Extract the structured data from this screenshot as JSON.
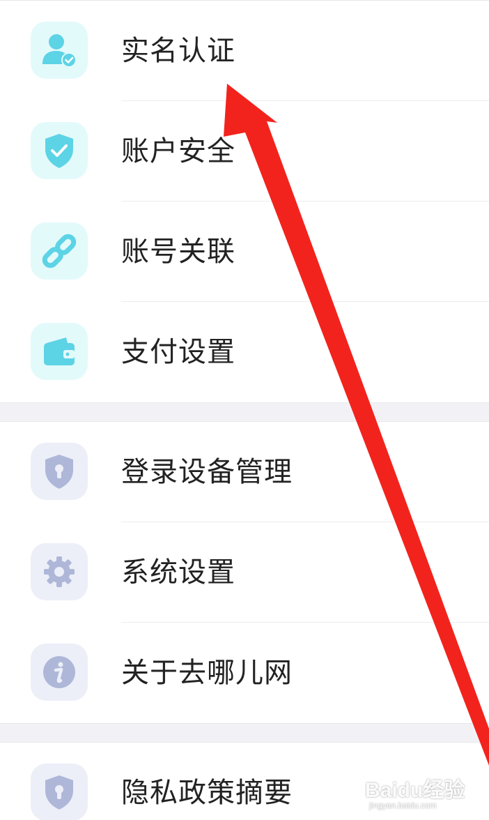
{
  "colors": {
    "teal_icon": "#5dd3e6",
    "teal_bg": "#e3fafb",
    "lavender_icon": "#aeb7d8",
    "lavender_bg": "#eceff8",
    "annotation_arrow": "#f2231d"
  },
  "sections": [
    {
      "items": [
        {
          "label": "实名认证",
          "icon": "user-verified-icon"
        },
        {
          "label": "账户安全",
          "icon": "shield-check-icon"
        },
        {
          "label": "账号关联",
          "icon": "link-icon"
        },
        {
          "label": "支付设置",
          "icon": "wallet-icon"
        }
      ]
    },
    {
      "items": [
        {
          "label": "登录设备管理",
          "icon": "shield-keyhole-icon"
        },
        {
          "label": "系统设置",
          "icon": "gear-icon"
        },
        {
          "label": "关于去哪儿网",
          "icon": "info-icon"
        }
      ]
    },
    {
      "items": [
        {
          "label": "隐私政策摘要",
          "icon": "shield-keyhole-icon"
        }
      ]
    }
  ],
  "watermark": {
    "main": "Baidu经验",
    "sub": "jingyan.baidu.com"
  }
}
